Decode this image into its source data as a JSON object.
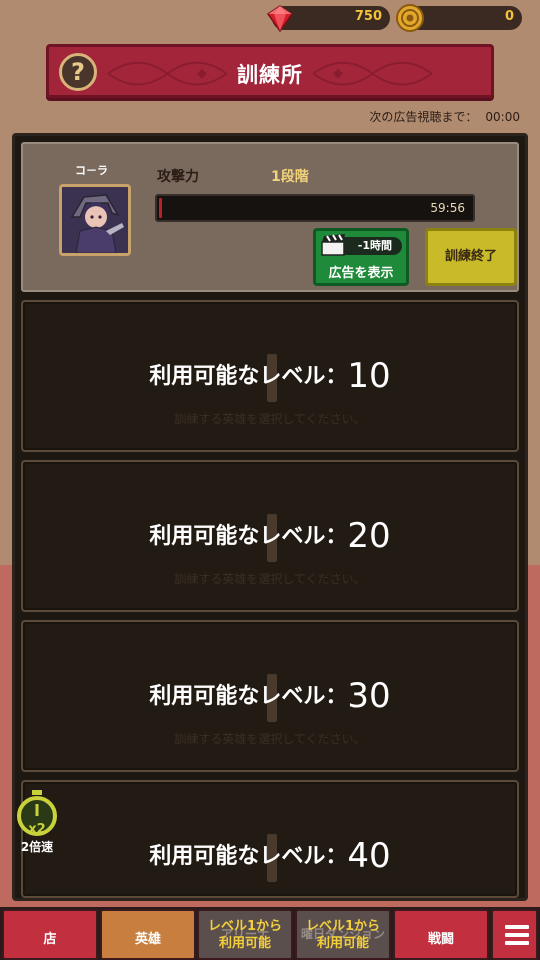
{
  "currency": {
    "gems": "750",
    "coins": "0"
  },
  "header": {
    "title": "訓練所",
    "help": "?",
    "ad_timer_label": "次の広告視聴まで：",
    "ad_timer_value": "00:00"
  },
  "active_training": {
    "hero_name": "コ－ラ",
    "stat": "攻撃力",
    "stage": "1段階",
    "time_remaining": "59:56",
    "progress": 0.01,
    "ad_button": {
      "badge": "-1時間",
      "label": "広告を表示"
    },
    "end_button": "訓練終了"
  },
  "slots": [
    {
      "label": "利用可能なレベル：",
      "level": "10",
      "hint": "訓練する英雄を選択してください。"
    },
    {
      "label": "利用可能なレベル：",
      "level": "20",
      "hint": "訓練する英雄を選択してください。"
    },
    {
      "label": "利用可能なレベル：",
      "level": "30",
      "hint": "訓練する英雄を選択してください。"
    },
    {
      "label": "利用可能なレベル：",
      "level": "40",
      "hint": ""
    }
  ],
  "speed": {
    "badge": "x2",
    "label": "2倍速"
  },
  "nav": {
    "shop": "店",
    "heroes": "英雄",
    "arena_line1": "レベル1から",
    "arena_line2": "利用可能",
    "arena_ghost": "アリーナ",
    "dungeon_line1": "レベル1から",
    "dungeon_line2": "利用可能",
    "dungeon_ghost": "曜日ダンジョン",
    "battle": "戦闘"
  },
  "colors": {
    "banner": "#a3253a",
    "progress_fill": "#b8202e",
    "ad_button": "#1f8a3a",
    "end_button": "#c8ba28",
    "level_hint": "#3a2f26"
  }
}
